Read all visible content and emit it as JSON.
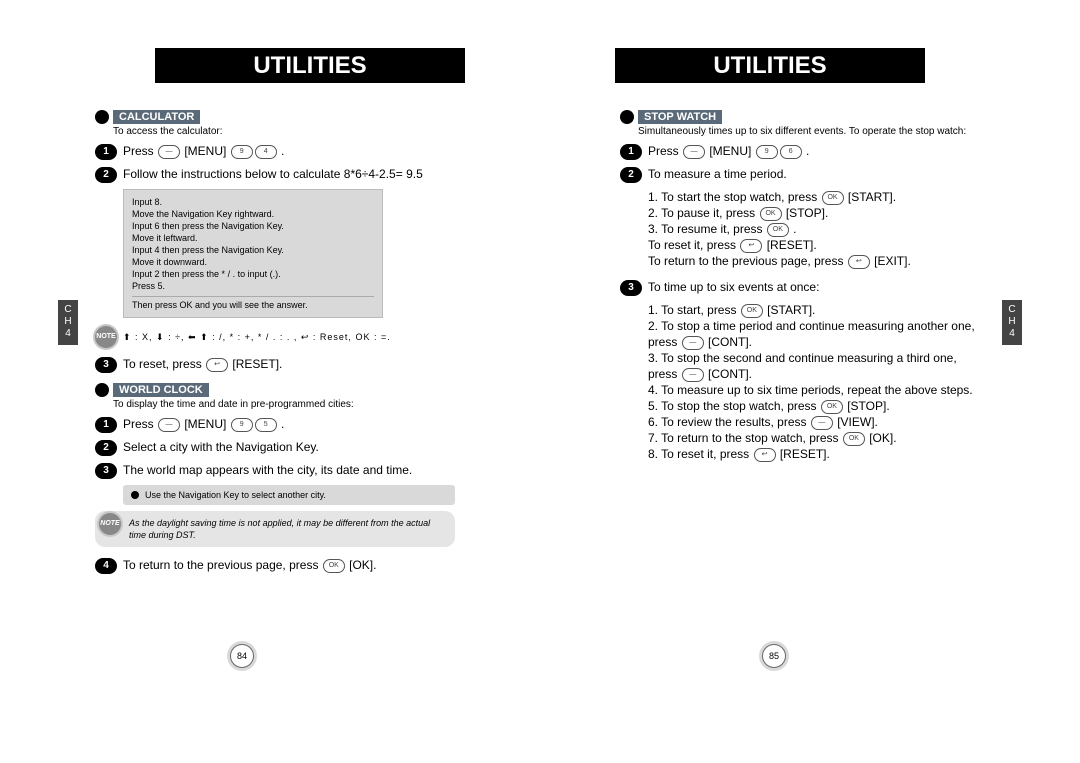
{
  "header": "UTILITIES",
  "chapter": {
    "label1": "C",
    "label2": "H",
    "num": "4"
  },
  "pageNumbers": {
    "left": "84",
    "right": "85"
  },
  "calculator": {
    "title": "CALCULATOR",
    "intro": "To access the calculator:",
    "step1_prefix": "Press ",
    "step1_menu": " [MENU] ",
    "step1_suffix": " .",
    "step2": "Follow the instructions below to calculate 8*6÷4-2.5= 9.5",
    "example_lines": [
      "Input 8.",
      "Move the Navigation Key rightward.",
      "Input 6 then press the Navigation Key.",
      "Move it leftward.",
      "Input 4 then press the Navigation Key.",
      "Move it downward.",
      "Input 2 then press the  * / .  to input (.).",
      "Press 5."
    ],
    "example_result": "Then press  OK  and you will see the answer.",
    "ops_text": "⬆ : X,   ⬇ : ÷,   ⬅ ⬆ : /,   * : +,   * / . : . ,   ↩ : Reset,   OK : =.",
    "step3_prefix": "To reset, press ",
    "step3_label": " [RESET]."
  },
  "worldclock": {
    "title": "WORLD CLOCK",
    "intro": "To display the time and date in pre-programmed cities:",
    "step1_prefix": "Press ",
    "step1_menu": " [MENU] ",
    "step1_suffix": " .",
    "step2": "Select a city with the Navigation Key.",
    "step3": "The world map appears with the city, its date and time.",
    "tip": "Use the Navigation Key to select another city.",
    "dst": "As the daylight saving time is not applied, it may be different from the actual time during DST.",
    "step4_prefix": "To return to the previous page, press ",
    "step4_label": " [OK]."
  },
  "stopwatch": {
    "title": "STOP WATCH",
    "intro": "Simultaneously times up to six different events. To operate the stop watch:",
    "step1_prefix": "Press ",
    "step1_menu": " [MENU] ",
    "step1_suffix": " .",
    "step2_head": "To measure a time period.",
    "step2_items": [
      {
        "pre": "1. To start the stop watch, press ",
        "key": "OK",
        "post": " [START]."
      },
      {
        "pre": "2. To pause it, press ",
        "key": "OK",
        "post": " [STOP]."
      },
      {
        "pre": "3. To resume it, press ",
        "key": "OK",
        "post": " ."
      },
      {
        "pre": "    To reset it, press ",
        "key": "↩",
        "post": " [RESET]."
      },
      {
        "pre": "    To return to the previous page, press ",
        "key": "↩",
        "post": " [EXIT]."
      }
    ],
    "step3_head": "To time up to six events at once:",
    "step3_items": [
      {
        "pre": "1. To start, press ",
        "key": "OK",
        "post": " [START]."
      },
      {
        "pre": "2. To stop a time period and continue measuring another one, press ",
        "key": "—",
        "post": " [CONT]."
      },
      {
        "pre": "3. To stop the second and continue measuring a third one, press ",
        "key": "—",
        "post": " [CONT]."
      },
      {
        "pre": "4. To measure up to six time periods, repeat the above steps.",
        "key": "",
        "post": ""
      },
      {
        "pre": "5. To stop the stop watch, press ",
        "key": "OK",
        "post": " [STOP]."
      },
      {
        "pre": "6. To review the results, press ",
        "key": "—",
        "post": " [VIEW]."
      },
      {
        "pre": "7. To return to the stop watch, press ",
        "key": "OK",
        "post": " [OK]."
      },
      {
        "pre": "8. To reset it, press ",
        "key": "↩",
        "post": " [RESET]."
      }
    ]
  }
}
